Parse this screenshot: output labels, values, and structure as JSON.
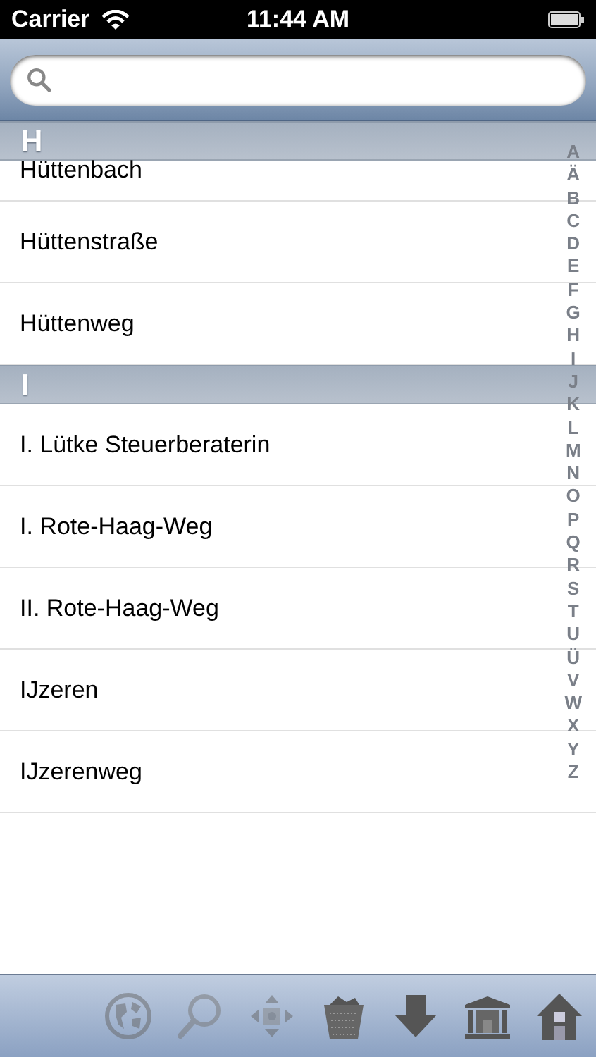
{
  "status_bar": {
    "carrier": "Carrier",
    "time": "11:44 AM"
  },
  "sections": [
    {
      "title": "H",
      "rows": [
        {
          "label": "Hüttenbach",
          "partial": true
        },
        {
          "label": "Hüttenstraße"
        },
        {
          "label": "Hüttenweg"
        }
      ]
    },
    {
      "title": "I",
      "rows": [
        {
          "label": "I. Lütke Steuerberaterin"
        },
        {
          "label": "I. Rote-Haag-Weg"
        },
        {
          "label": "II. Rote-Haag-Weg"
        },
        {
          "label": "IJzeren"
        },
        {
          "label": "IJzerenweg"
        }
      ]
    }
  ],
  "index": [
    "A",
    "Ä",
    "B",
    "C",
    "D",
    "E",
    "F",
    "G",
    "H",
    "I",
    "J",
    "K",
    "L",
    "M",
    "N",
    "O",
    "P",
    "Q",
    "R",
    "S",
    "T",
    "U",
    "Ü",
    "V",
    "W",
    "X",
    "Y",
    "Z"
  ],
  "toolbar": [
    {
      "kind": "globe",
      "disabled": true
    },
    {
      "kind": "search",
      "disabled": true
    },
    {
      "kind": "move",
      "disabled": true
    },
    {
      "kind": "basket",
      "disabled": false
    },
    {
      "kind": "download",
      "disabled": false
    },
    {
      "kind": "bank",
      "disabled": false
    },
    {
      "kind": "home",
      "disabled": false
    }
  ]
}
